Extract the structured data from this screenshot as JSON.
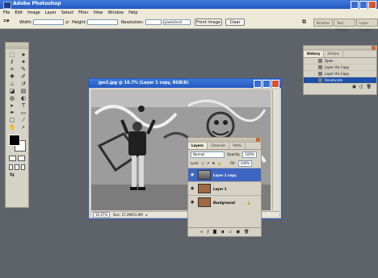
{
  "app": {
    "title": "Adobe Photoshop"
  },
  "menu": [
    "File",
    "Edit",
    "Image",
    "Layer",
    "Select",
    "Filter",
    "View",
    "Window",
    "Help"
  ],
  "options": {
    "width_label": "Width:",
    "height_label": "Height:",
    "resolution_label": "Resolution:",
    "units_value": "pixels/inch",
    "front_image_label": "Front Image",
    "clear_label": "Clear",
    "well_tabs": [
      "Brushes",
      "Tool Presets",
      "Layer Comps"
    ]
  },
  "history": {
    "tabs": [
      "History",
      "Actions"
    ],
    "items": [
      {
        "label": "Open",
        "selected": false
      },
      {
        "label": "Layer Via Copy",
        "selected": false
      },
      {
        "label": "Layer Via Copy",
        "selected": false
      },
      {
        "label": "Desaturate",
        "selected": true
      }
    ]
  },
  "document": {
    "title": "jpn2.jpg @ 16.7% (Layer 1 copy, RGB/8)",
    "zoom": "16.67%",
    "doc_size": "Doc: 17.2M/51.6M"
  },
  "layers": {
    "tabs": [
      "Layers",
      "Channels",
      "Paths"
    ],
    "blend_mode": "Normal",
    "opacity_label": "Opacity:",
    "opacity_value": "100%",
    "lock_label": "Lock:",
    "fill_label": "Fill:",
    "fill_value": "100%",
    "items": [
      {
        "name": "Layer 1 copy",
        "selected": true
      },
      {
        "name": "Layer 1",
        "selected": false
      },
      {
        "name": "Background",
        "selected": false
      }
    ]
  },
  "colors": {
    "titlebar": "#2458c2",
    "workspace": "#5e6269",
    "panel": "#d6d3c6",
    "selection": "#3f66c2"
  }
}
